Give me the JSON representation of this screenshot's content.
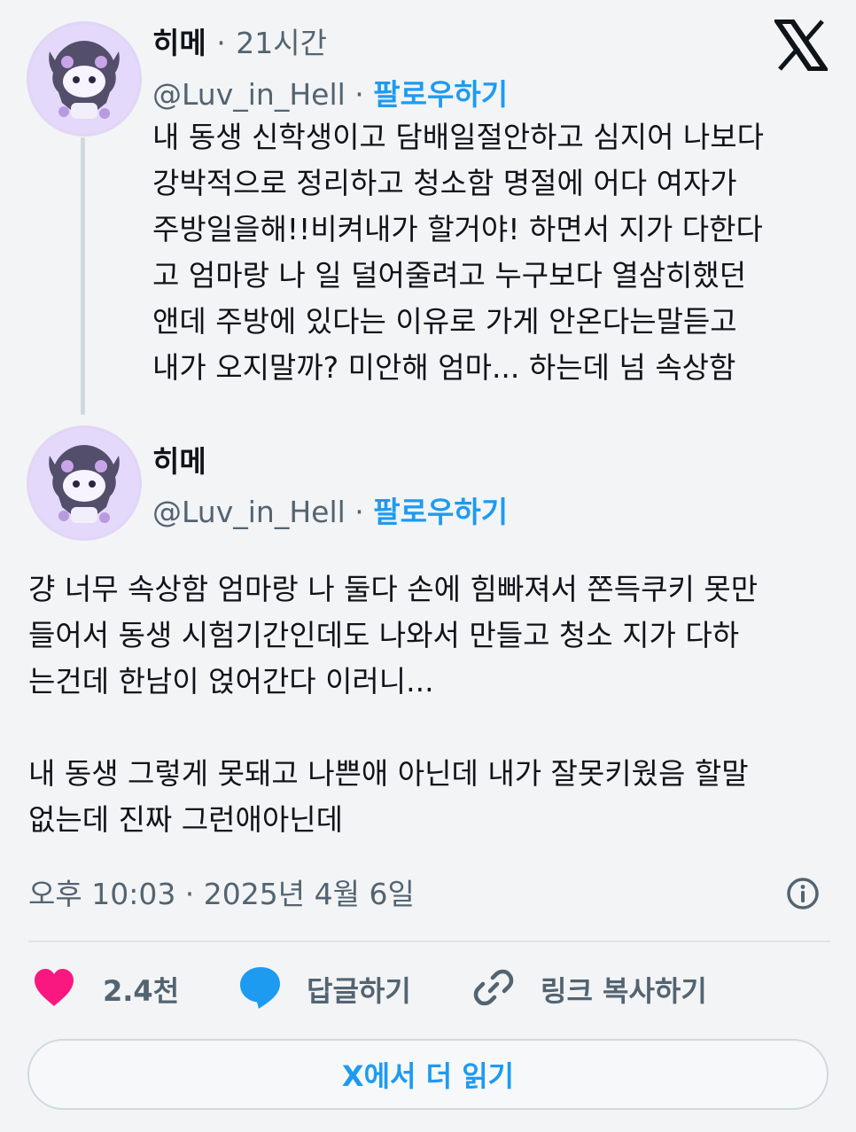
{
  "tweet1": {
    "author_name": "히메",
    "separator": "·",
    "time_ago": "21시간",
    "handle": "@Luv_in_Hell",
    "follow_label": "팔로우하기",
    "text": "내 동생 신학생이고 담배일절안하고 심지어 나보다\n강박적으로 정리하고 청소함 명절에 어다 여자가\n주방일을해!!비켜내가 할거야! 하면서 지가 다한다\n고 엄마랑 나 일 덜어줄려고 누구보다 열삼히했던\n앤데 주방에 있다는 이유로 가게 안온다는말듣고\n내가 오지말까? 미안해 엄마... 하는데 넘 속상함"
  },
  "tweet2": {
    "author_name": "히메",
    "separator": "·",
    "handle": "@Luv_in_Hell",
    "follow_label": "팔로우하기",
    "text": "걍 너무 속상함 엄마랑 나 둘다 손에 힘빠져서 쫀득쿠키 못만\n들어서 동생 시험기간인데도 나와서 만들고 청소 지가 다하\n는건데 한남이 얹어간다 이러니...\n\n내 동생 그렇게 못돼고 나쁜애 아닌데 내가 잘못키웠음 할말\n없는데 진짜 그런애아닌데",
    "timestamp": "오후 10:03 · 2025년 4월 6일"
  },
  "actions": {
    "like_count": "2.4천",
    "reply_label": "답글하기",
    "copy_link_label": "링크 복사하기"
  },
  "read_more_label": "X에서 더 읽기",
  "icons": {
    "brand": "x-logo-icon",
    "info": "info-icon",
    "like": "heart-icon",
    "reply": "speech-bubble-icon",
    "link": "link-icon"
  },
  "colors": {
    "accent": "#1d9bf0",
    "heart": "#f91880",
    "muted_text": "#536471",
    "text": "#0f1419",
    "background": "#f3f4f6"
  }
}
